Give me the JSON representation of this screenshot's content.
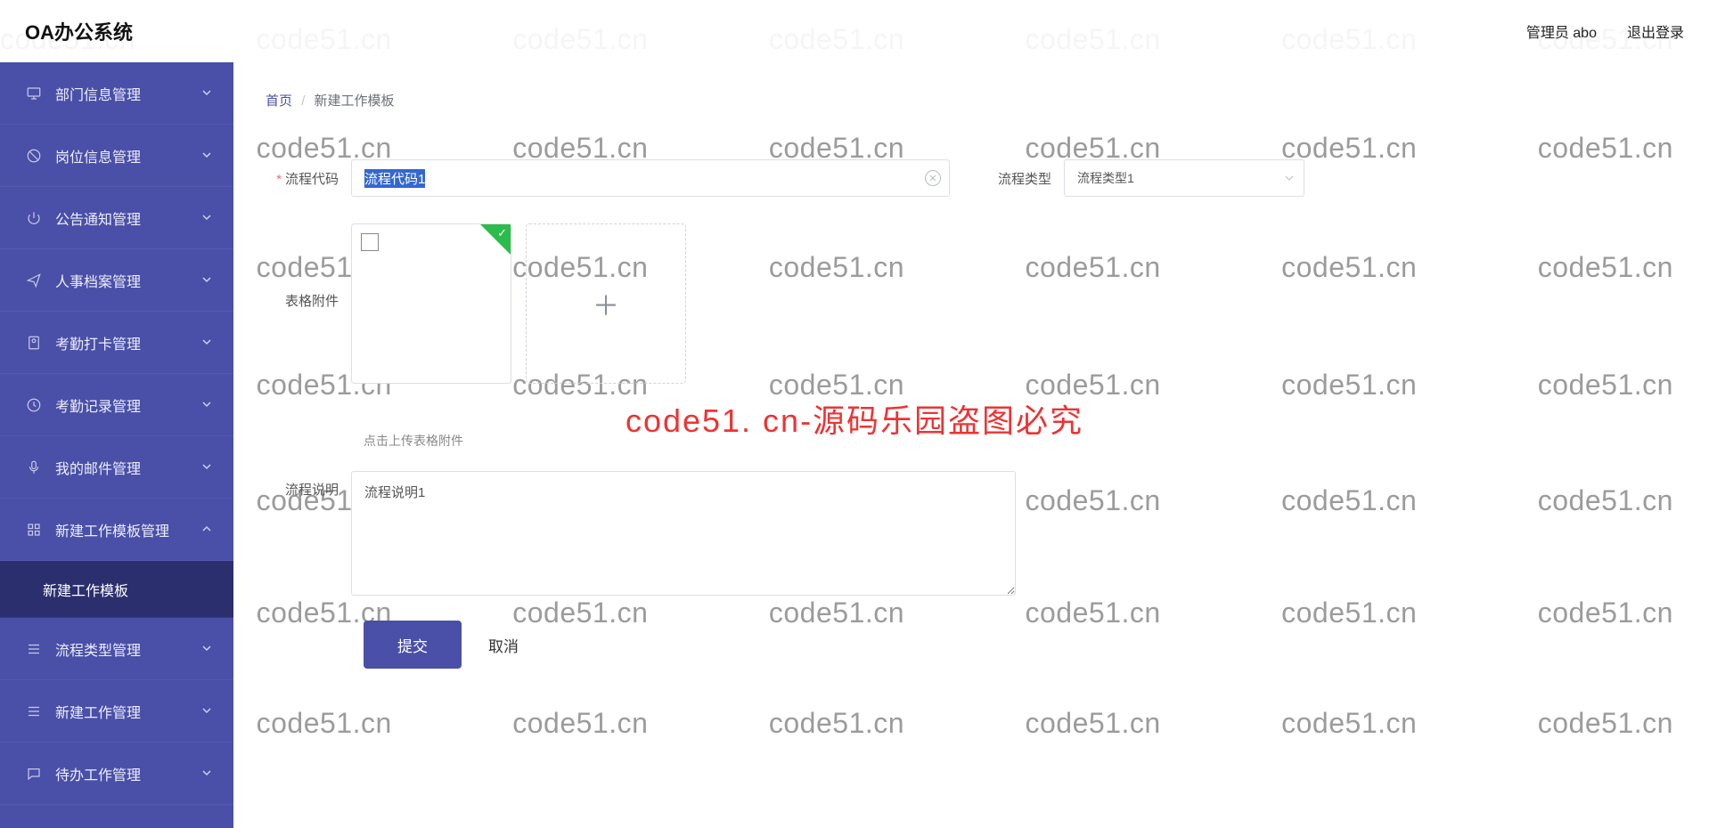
{
  "header": {
    "brand": "OA办公系统",
    "user": "管理员 abo",
    "logout": "退出登录"
  },
  "sidebar": {
    "items": [
      {
        "icon": "monitor",
        "label": "部门信息管理",
        "open": false
      },
      {
        "icon": "ban",
        "label": "岗位信息管理",
        "open": false
      },
      {
        "icon": "power",
        "label": "公告通知管理",
        "open": false
      },
      {
        "icon": "send",
        "label": "人事档案管理",
        "open": false
      },
      {
        "icon": "user",
        "label": "考勤打卡管理",
        "open": false
      },
      {
        "icon": "clock",
        "label": "考勤记录管理",
        "open": false
      },
      {
        "icon": "mic",
        "label": "我的邮件管理",
        "open": false
      },
      {
        "icon": "grid",
        "label": "新建工作模板管理",
        "open": true,
        "sub": [
          {
            "label": "新建工作模板"
          }
        ]
      },
      {
        "icon": "list",
        "label": "流程类型管理",
        "open": false
      },
      {
        "icon": "list",
        "label": "新建工作管理",
        "open": false
      },
      {
        "icon": "chat",
        "label": "待办工作管理",
        "open": false
      }
    ]
  },
  "breadcrumb": {
    "home": "首页",
    "current": "新建工作模板"
  },
  "form": {
    "code_label": "流程代码",
    "code_value": "流程代码1",
    "type_label": "流程类型",
    "type_value": "流程类型1",
    "attach_label": "表格附件",
    "attach_hint": "点击上传表格附件",
    "desc_label": "流程说明",
    "desc_value": "流程说明1",
    "submit": "提交",
    "cancel": "取消"
  },
  "watermark": {
    "text": "code51.cn",
    "center": "code51. cn-源码乐园盗图必究"
  }
}
